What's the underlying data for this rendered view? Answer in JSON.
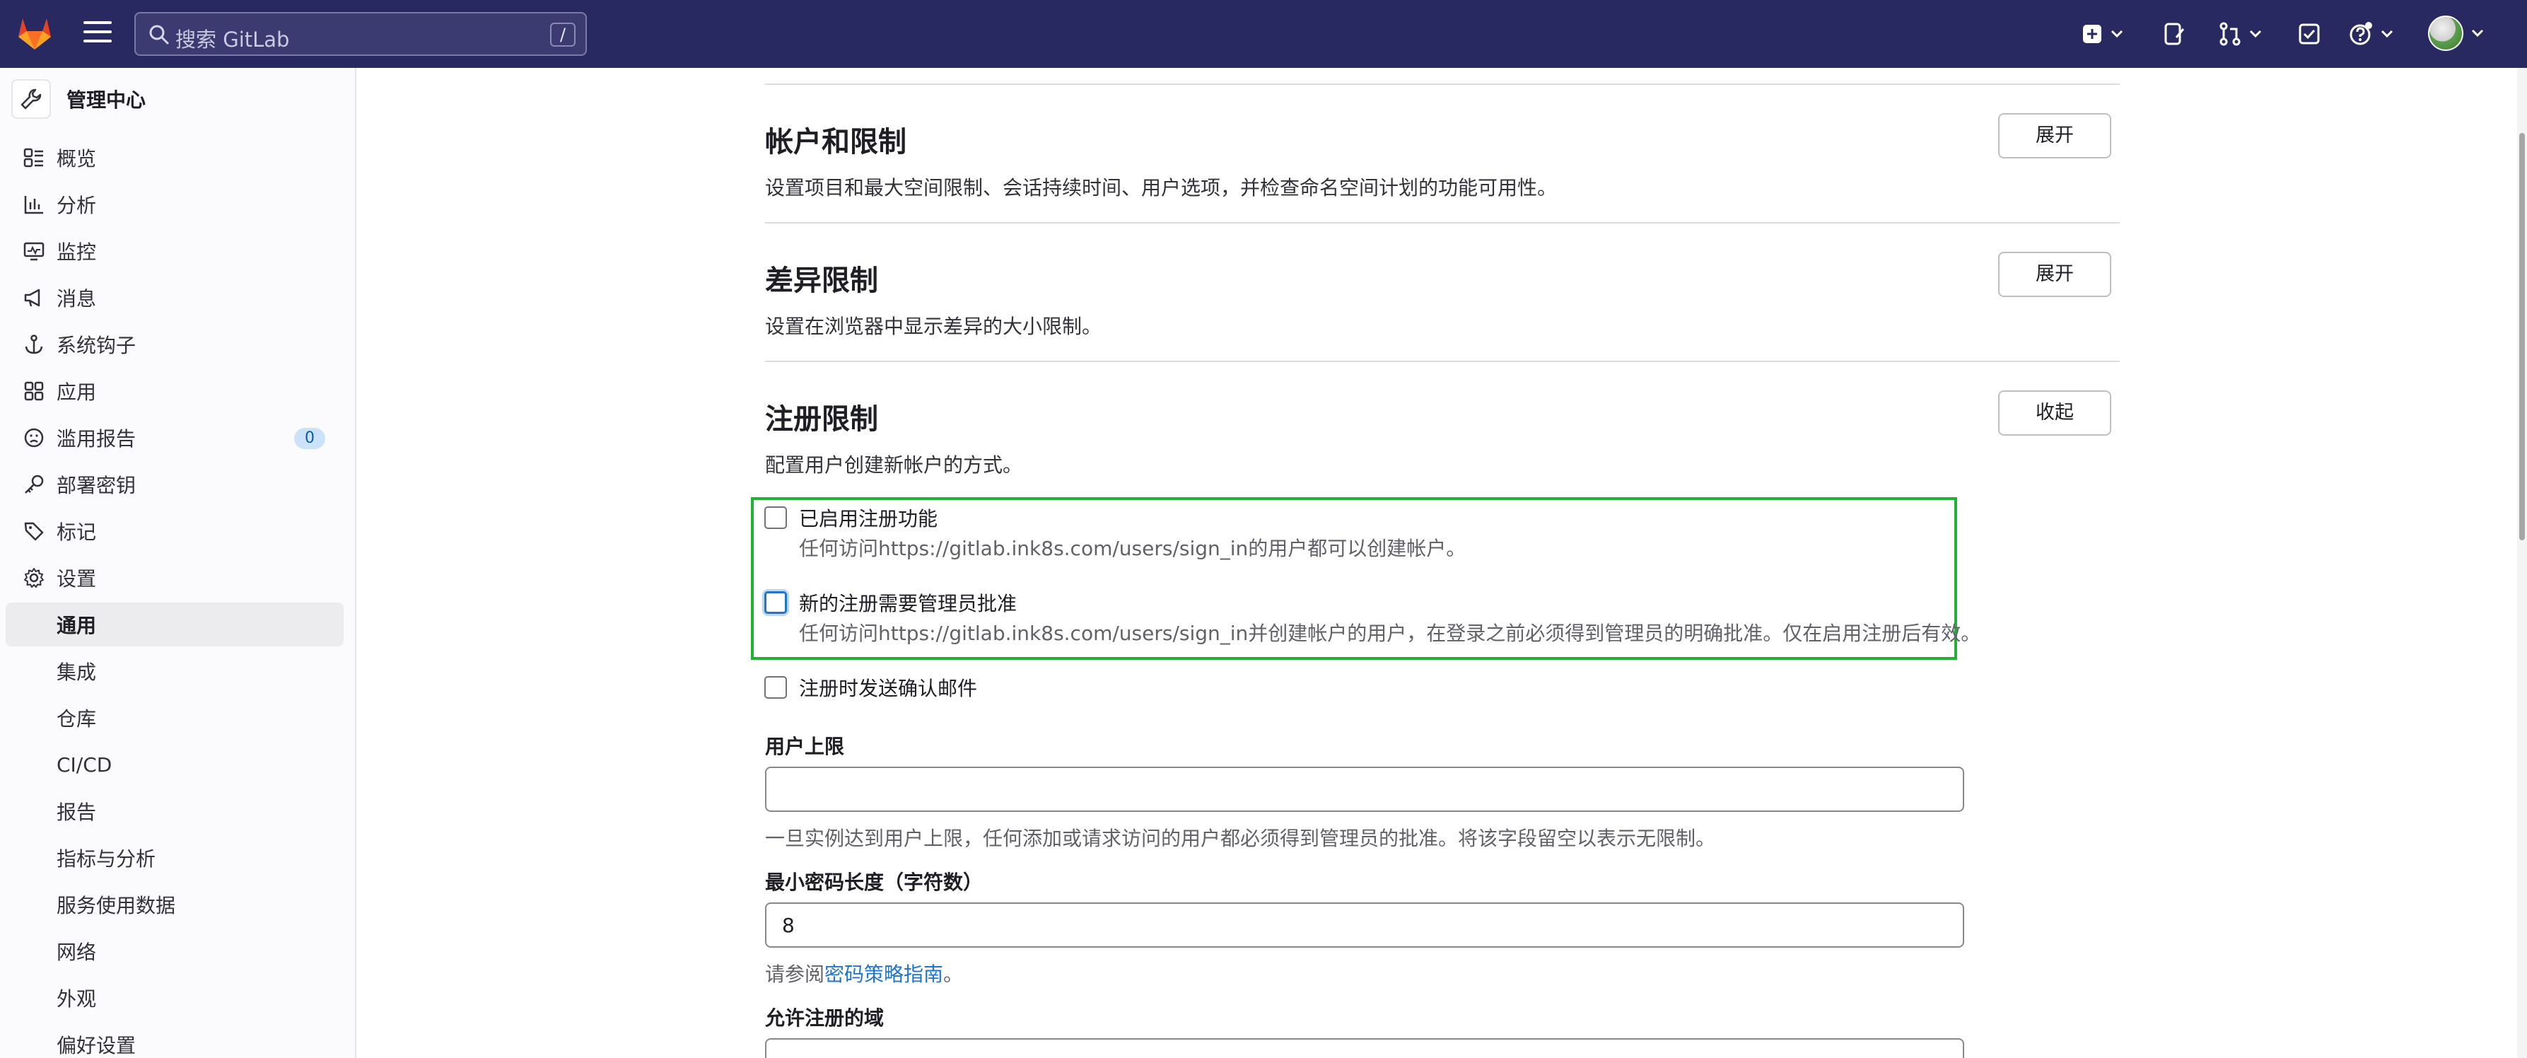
{
  "topbar": {
    "search_placeholder": "搜索 GitLab",
    "search_shortcut": "/",
    "colors": {
      "background": "#292961"
    },
    "icons": [
      "gitlab-logo-icon",
      "hamburger-icon",
      "search-icon",
      "new-item-icon",
      "issues-icon",
      "merge-requests-icon",
      "todos-icon",
      "help-icon",
      "avatar"
    ]
  },
  "sidebar": {
    "title": "管理中心",
    "items": [
      {
        "label": "概览",
        "icon": "overview-icon"
      },
      {
        "label": "分析",
        "icon": "analytics-icon"
      },
      {
        "label": "监控",
        "icon": "monitor-icon"
      },
      {
        "label": "消息",
        "icon": "messages-icon"
      },
      {
        "label": "系统钩子",
        "icon": "hook-icon"
      },
      {
        "label": "应用",
        "icon": "applications-icon"
      },
      {
        "label": "滥用报告",
        "icon": "abuse-icon",
        "badge": "0"
      },
      {
        "label": "部署密钥",
        "icon": "key-icon"
      },
      {
        "label": "标记",
        "icon": "label-icon"
      },
      {
        "label": "设置",
        "icon": "settings-icon"
      }
    ],
    "subitems": [
      {
        "label": "通用",
        "active": true
      },
      {
        "label": "集成"
      },
      {
        "label": "仓库"
      },
      {
        "label": "CI/CD"
      },
      {
        "label": "报告"
      },
      {
        "label": "指标与分析"
      },
      {
        "label": "服务使用数据"
      },
      {
        "label": "网络"
      },
      {
        "label": "外观"
      },
      {
        "label": "偏好设置"
      }
    ]
  },
  "sections": [
    {
      "title": "帐户和限制",
      "description": "设置项目和最大空间限制、会话持续时间、用户选项，并检查命名空间计划的功能可用性。",
      "button": "展开"
    },
    {
      "title": "差异限制",
      "description": "设置在浏览器中显示差异的大小限制。",
      "button": "展开"
    },
    {
      "title": "注册限制",
      "description": "配置用户创建新帐户的方式。",
      "button": "收起"
    }
  ],
  "signup": {
    "checkbox_enabled": {
      "label": "已启用注册功能",
      "help": "任何访问https://gitlab.ink8s.com/users/sign_in的用户都可以创建帐户。",
      "checked": false
    },
    "checkbox_approval": {
      "label": "新的注册需要管理员批准",
      "help": "任何访问https://gitlab.ink8s.com/users/sign_in并创建帐户的用户，在登录之前必须得到管理员的明确批准。仅在启用注册后有效。",
      "checked": false
    },
    "checkbox_email": {
      "label": "注册时发送确认邮件",
      "checked": false
    },
    "user_cap": {
      "label": "用户上限",
      "value": "",
      "help": "一旦实例达到用户上限，任何添加或请求访问的用户都必须得到管理员的批准。将该字段留空以表示无限制。"
    },
    "min_password": {
      "label": "最小密码长度（字符数）",
      "value": "8",
      "help_prefix": "请参阅",
      "help_link": "密码策略指南",
      "help_suffix": "。"
    },
    "allowed_domains": {
      "label": "允许注册的域"
    }
  },
  "colors": {
    "highlight_box": "#20b234",
    "link": "#1f75cb",
    "badge_bg": "#cbe2f9"
  }
}
